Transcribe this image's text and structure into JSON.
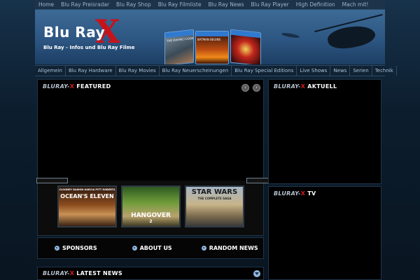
{
  "topnav": [
    "Home",
    "Blu Ray Preisradar",
    "Blu Ray Shop",
    "Blu Ray Filmliste",
    "Blu Ray News",
    "Blu Ray Player",
    "High Definition",
    "Mach mit!"
  ],
  "header": {
    "logo_text": "Blu Ray",
    "logo_x": "X",
    "tagline": "Blu Ray - Infos und Blu Ray Filme",
    "covers": [
      {
        "caption": "THE DAVINCI CODE",
        "icon": "disc-cover-icon"
      },
      {
        "caption": "BATMAN BEGINS",
        "icon": "disc-cover-icon"
      },
      {
        "caption": "",
        "icon": "disc-cover-icon"
      }
    ]
  },
  "mainnav": [
    "Allgemein",
    "Blu Ray Hardware",
    "Blu Ray Movies",
    "Blu Ray Neuerscheinungen",
    "Blu Ray Special Editions",
    "Live Shows",
    "News",
    "Serien",
    "Technik"
  ],
  "featured": {
    "title_brand": "BLURAY-",
    "title_x": "X",
    "title_rest": " FEATURED",
    "prev": "‹",
    "next": "›",
    "thumbs": [
      {
        "title": "OCEAN'S ELEVEN",
        "sub": "CLOONEY DAMON GARCIA PITT ROBERTS"
      },
      {
        "title": "HANGOVER",
        "sub": "2"
      },
      {
        "title": "STAR WARS",
        "sub": "THE COMPLETE SAGA"
      }
    ]
  },
  "aktuell": {
    "title_brand": "BLURAY-",
    "title_x": "X",
    "title_rest": " AKTUELL"
  },
  "tv": {
    "title_brand": "BLURAY-",
    "title_x": "X",
    "title_rest": " TV"
  },
  "footer_links": [
    "SPONSORS",
    "ABOUT US",
    "RANDOM NEWS"
  ],
  "latest": {
    "title_brand": "BLURAY-",
    "title_x": "X",
    "title_rest": " LATEST NEWS"
  },
  "colors": {
    "accent_red": "#c8121a",
    "bg": "#0a1622",
    "panel": "#000000",
    "nav": "#1c3349"
  }
}
